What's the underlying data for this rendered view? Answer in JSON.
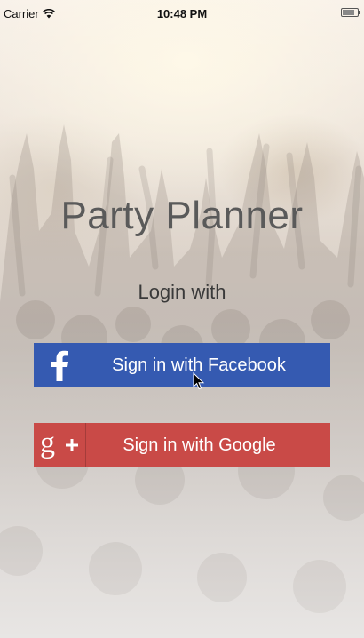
{
  "status_bar": {
    "carrier": "Carrier",
    "time": "10:48 PM"
  },
  "app": {
    "title": "Party Planner",
    "subtitle": "Login with"
  },
  "buttons": {
    "facebook": {
      "label": "Sign in with Facebook",
      "icon": "facebook-icon",
      "color": "#355ab1"
    },
    "google": {
      "label": "Sign in with Google",
      "icon": "google-plus-icon",
      "color": "#c94a47"
    }
  }
}
